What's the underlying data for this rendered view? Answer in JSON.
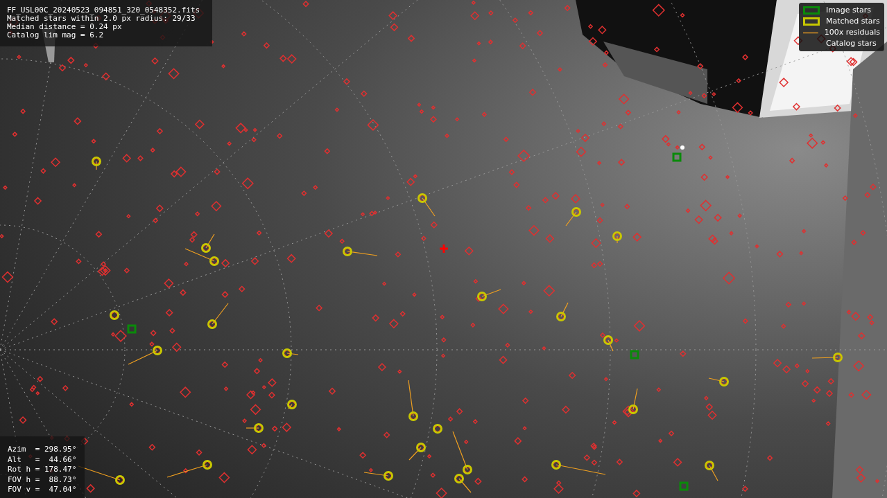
{
  "info_box": {
    "lines": [
      "FF_USL00C_20240523_094851_320_0548352.fits",
      "Matched stars within 2.0 px radius: 29/33",
      "Median distance = 0.24 px",
      "Catalog lim mag = 6.2"
    ]
  },
  "legend": {
    "items": [
      {
        "label": "Image stars"
      },
      {
        "label": "Matched stars",
        "kind": "matched"
      },
      {
        "label": "100x residuals",
        "kind": "residual"
      },
      {
        "label": "Catalog stars",
        "kind": "catalog"
      }
    ]
  },
  "pointing": {
    "lines": [
      "Azim  = 298.95°",
      "Alt   =  44.66°",
      "Rot h = 178.47°",
      "FOV h =  88.73°",
      "FOV v =  47.04°"
    ]
  }
}
